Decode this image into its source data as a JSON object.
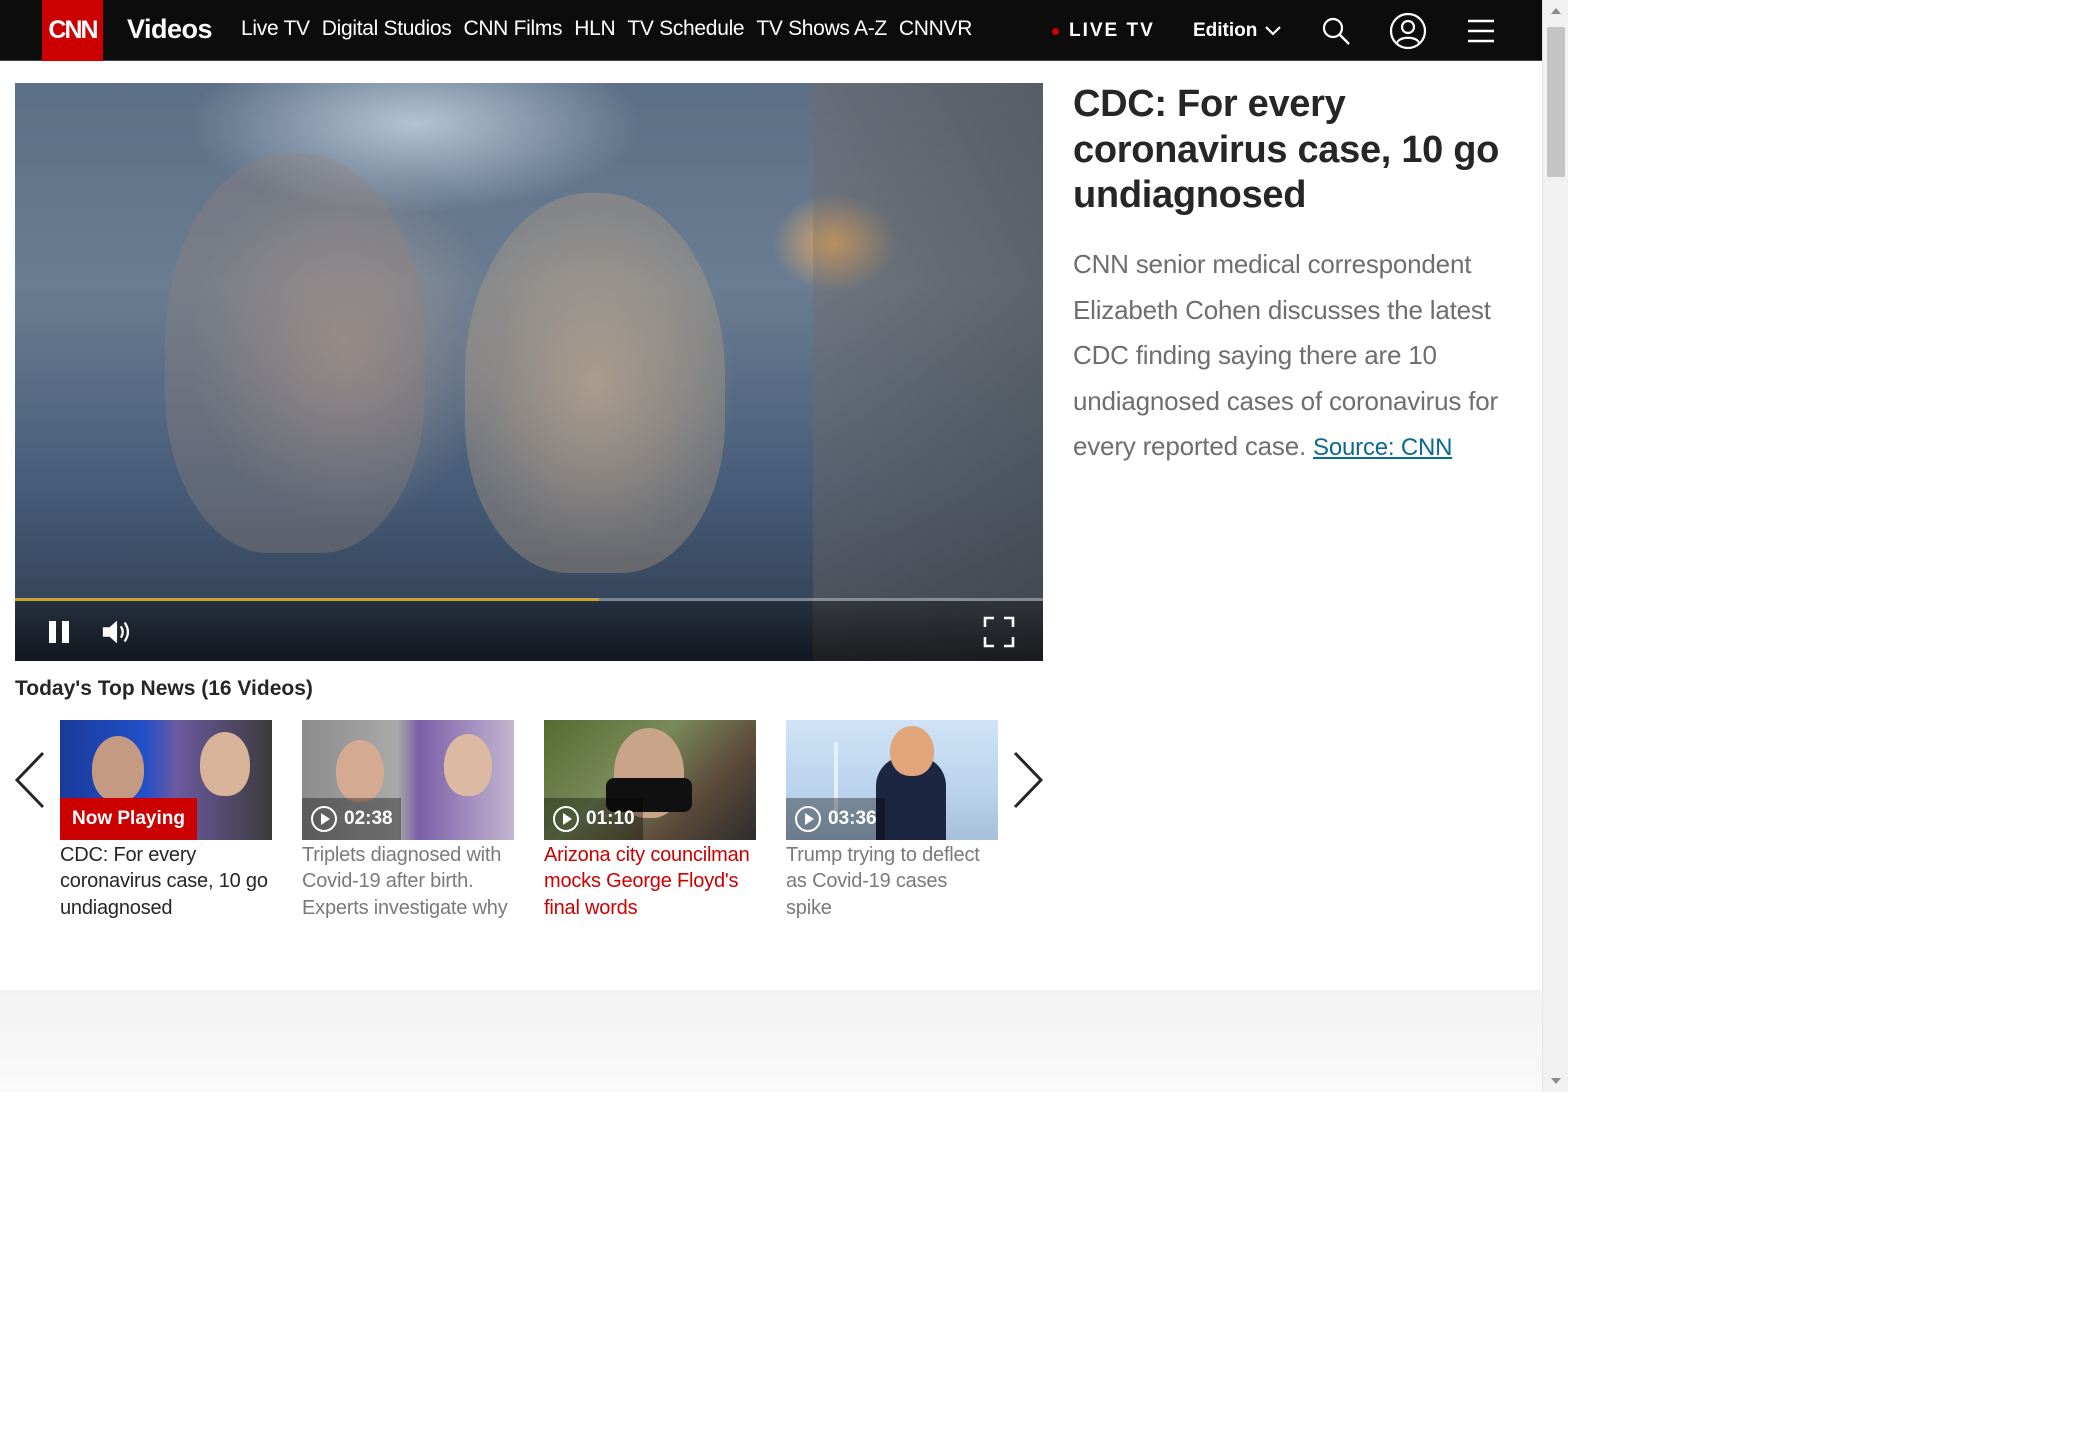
{
  "header": {
    "logo_text": "CNN",
    "section_title": "Videos",
    "nav": [
      "Live TV",
      "Digital Studios",
      "CNN Films",
      "HLN",
      "TV Schedule",
      "TV Shows A-Z",
      "CNNVR"
    ],
    "live_label": "LIVE TV",
    "edition_label": "Edition",
    "icons": [
      "search-icon",
      "account-icon",
      "menu-icon"
    ]
  },
  "player": {
    "progress_fraction": 0.568,
    "icons": [
      "pause-icon",
      "volume-icon",
      "fullscreen-icon"
    ]
  },
  "article": {
    "headline": "CDC: For every coronavirus case, 10 go undiagnosed",
    "description": "CNN senior medical correspondent Elizabeth Cohen discusses the latest CDC finding saying there are 10 undiagnosed cases of coronavirus for every reported case.",
    "source": "Source: CNN"
  },
  "carousel": {
    "title": "Today's Top News (16 Videos)",
    "items": [
      {
        "badge": "Now Playing",
        "title": "CDC: For every coronavirus case, 10 go undiagnosed"
      },
      {
        "badge": "02:38",
        "title": "Triplets diagnosed with Covid-19 after birth. Experts investigate why"
      },
      {
        "badge": "01:10",
        "title": "Arizona city councilman mocks George Floyd's final words"
      },
      {
        "badge": "03:36",
        "title": "Trump trying to deflect as Covid-19 cases spike"
      }
    ]
  },
  "colors": {
    "brand_red": "#cc0000",
    "progress": "#c9a437",
    "link_blue": "#0c6a92"
  }
}
